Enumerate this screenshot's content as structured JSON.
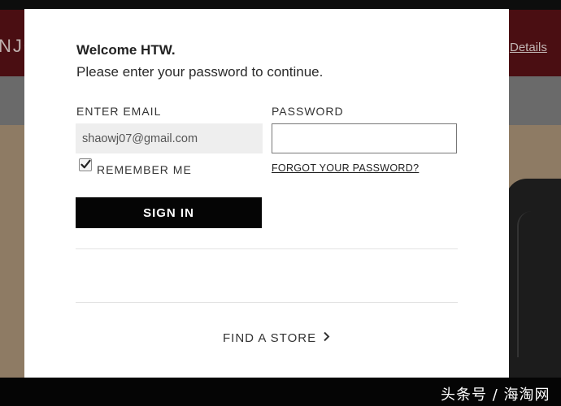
{
  "background": {
    "brand_fragment": "NJO",
    "details_link": "Details"
  },
  "modal": {
    "welcome": "Welcome HTW.",
    "prompt": "Please enter your password to continue.",
    "email_label": "ENTER EMAIL",
    "email_value": "shaowj07@gmail.com",
    "password_label": "PASSWORD",
    "password_value": "",
    "remember_checked": true,
    "remember_label": "REMEMBER ME",
    "forgot_link": "FORGOT YOUR PASSWORD?",
    "signin_label": "SIGN IN",
    "find_store_label": "FIND A STORE"
  },
  "watermark": "头条号 / 海淘网",
  "icons": {
    "remember": "checkmark-icon",
    "find_store": "chevron-right-icon"
  }
}
